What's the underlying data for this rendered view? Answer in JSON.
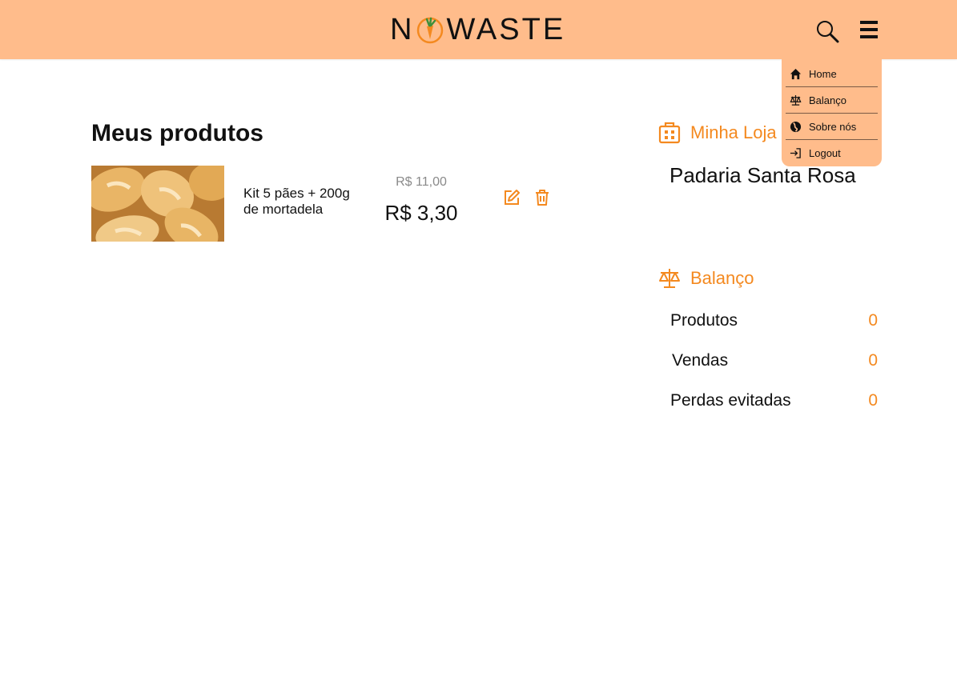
{
  "header": {
    "logo_text_left": "N",
    "logo_text_right": "WASTE",
    "search_icon": "search-icon",
    "menu_icon": "hamburger-icon",
    "bg_color": "#ffbc8b"
  },
  "dropdown": {
    "items": [
      {
        "label": "Home",
        "icon": "home-icon"
      },
      {
        "label": "Balanço",
        "icon": "scale-icon"
      },
      {
        "label": "Sobre nós",
        "icon": "globe-icon"
      },
      {
        "label": "Logout",
        "icon": "logout-icon"
      }
    ]
  },
  "products": {
    "title": "Meus produtos",
    "items": [
      {
        "name": "Kit 5 pães + 200g de mortadela",
        "price_old": "R$ 11,00",
        "price_new": "R$ 3,30",
        "edit_icon": "edit-icon",
        "delete_icon": "trash-icon"
      }
    ]
  },
  "store": {
    "heading": "Minha Loja",
    "icon": "store-icon",
    "name": "Padaria Santa Rosa"
  },
  "balance": {
    "heading": "Balanço",
    "icon": "scale-icon",
    "stats": [
      {
        "label": "Produtos",
        "value": "0"
      },
      {
        "label": "Vendas",
        "value": "0"
      },
      {
        "label": "Perdas evitadas",
        "value": "0"
      }
    ]
  },
  "colors": {
    "accent": "#f4891f",
    "header": "#ffbc8b"
  }
}
